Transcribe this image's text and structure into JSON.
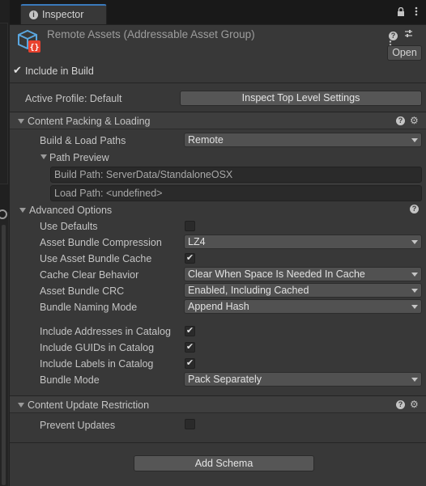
{
  "tab": {
    "title": "Inspector",
    "icon": "info-icon"
  },
  "tab_icons": {
    "lock": "lock-icon",
    "menu": "kebab-menu-icon"
  },
  "header": {
    "title": "Remote Assets (Addressable Asset Group)",
    "icon": "addressable-group-icon",
    "help_icon": "?",
    "open_button": "Open"
  },
  "include_in_build": {
    "label": "Include in Build",
    "checked": true
  },
  "active_profile": {
    "label": "Active Profile: Default",
    "button": "Inspect Top Level Settings"
  },
  "content_packing": {
    "title": "Content Packing & Loading",
    "build_load_paths": {
      "label": "Build & Load Paths",
      "value": "Remote"
    },
    "path_preview": {
      "label": "Path Preview",
      "build_path": "Build Path: ServerData/StandaloneOSX",
      "load_path": "Load Path: <undefined>"
    },
    "advanced": {
      "title": "Advanced Options",
      "use_defaults": {
        "label": "Use Defaults",
        "checked": false
      },
      "compression": {
        "label": "Asset Bundle Compression",
        "value": "LZ4"
      },
      "use_cache": {
        "label": "Use Asset Bundle Cache",
        "checked": true
      },
      "cache_clear": {
        "label": "Cache Clear Behavior",
        "value": "Clear When Space Is Needed In Cache"
      },
      "crc": {
        "label": "Asset Bundle CRC",
        "value": "Enabled, Including Cached"
      },
      "naming": {
        "label": "Bundle Naming Mode",
        "value": "Append Hash"
      },
      "include_addresses": {
        "label": "Include Addresses in Catalog",
        "checked": true
      },
      "include_guids": {
        "label": "Include GUIDs in Catalog",
        "checked": true
      },
      "include_labels": {
        "label": "Include Labels in Catalog",
        "checked": true
      },
      "bundle_mode": {
        "label": "Bundle Mode",
        "value": "Pack Separately"
      }
    }
  },
  "content_update": {
    "title": "Content Update Restriction",
    "prevent_updates": {
      "label": "Prevent Updates",
      "checked": false
    }
  },
  "add_schema": "Add Schema",
  "check_glyph": "✔",
  "colors": {
    "accent": "#3a79bb",
    "panel_bg": "#383838",
    "dropdown_bg": "#515151"
  }
}
